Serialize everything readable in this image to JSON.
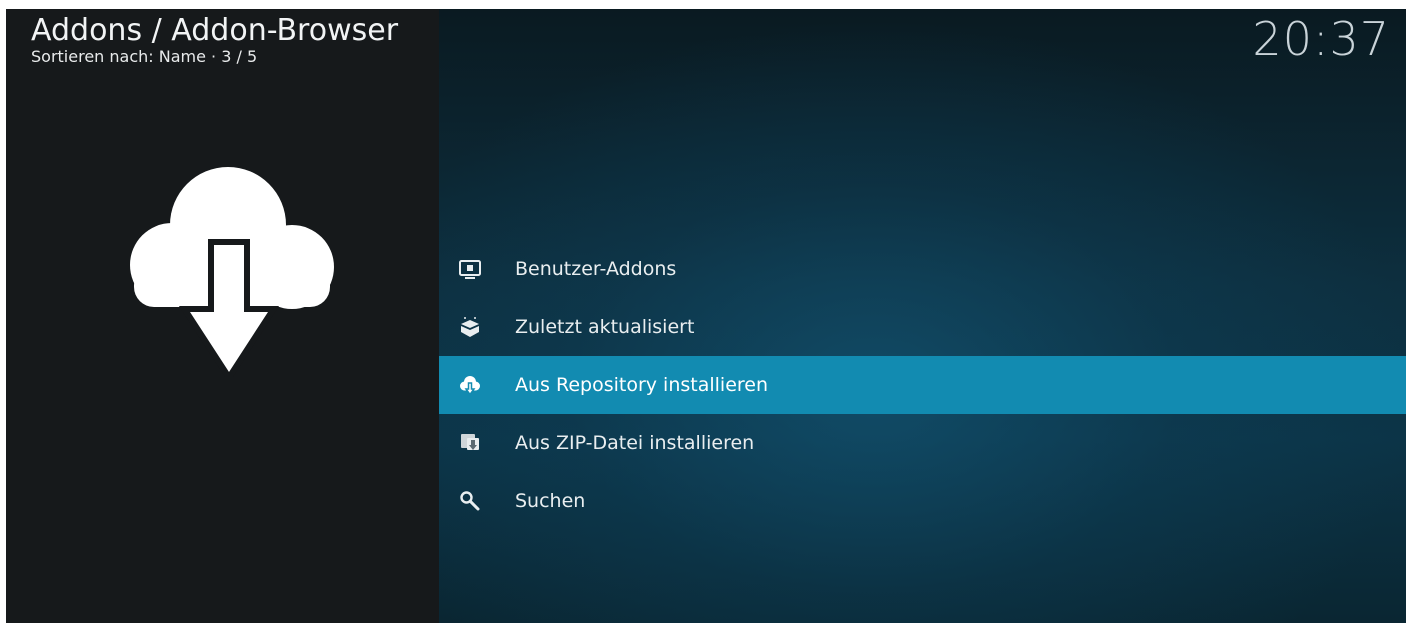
{
  "header": {
    "title": "Addons / Addon-Browser",
    "subtitle": "Sortieren nach: Name  ·  3 / 5"
  },
  "clock": "20:37",
  "preview": {
    "icon": "cloud-download-icon"
  },
  "menu": {
    "items": [
      {
        "label": "Benutzer-Addons",
        "icon": "monitor-box-icon",
        "selected": false
      },
      {
        "label": "Zuletzt aktualisiert",
        "icon": "open-box-icon",
        "selected": false
      },
      {
        "label": "Aus Repository installieren",
        "icon": "cloud-download-icon",
        "selected": true
      },
      {
        "label": "Aus ZIP-Datei installieren",
        "icon": "zip-install-icon",
        "selected": false
      },
      {
        "label": "Suchen",
        "icon": "search-icon",
        "selected": false
      }
    ]
  },
  "colors": {
    "highlight": "#128bb1",
    "left_panel": "#16191b",
    "background_accent": "#0d2f3f"
  }
}
